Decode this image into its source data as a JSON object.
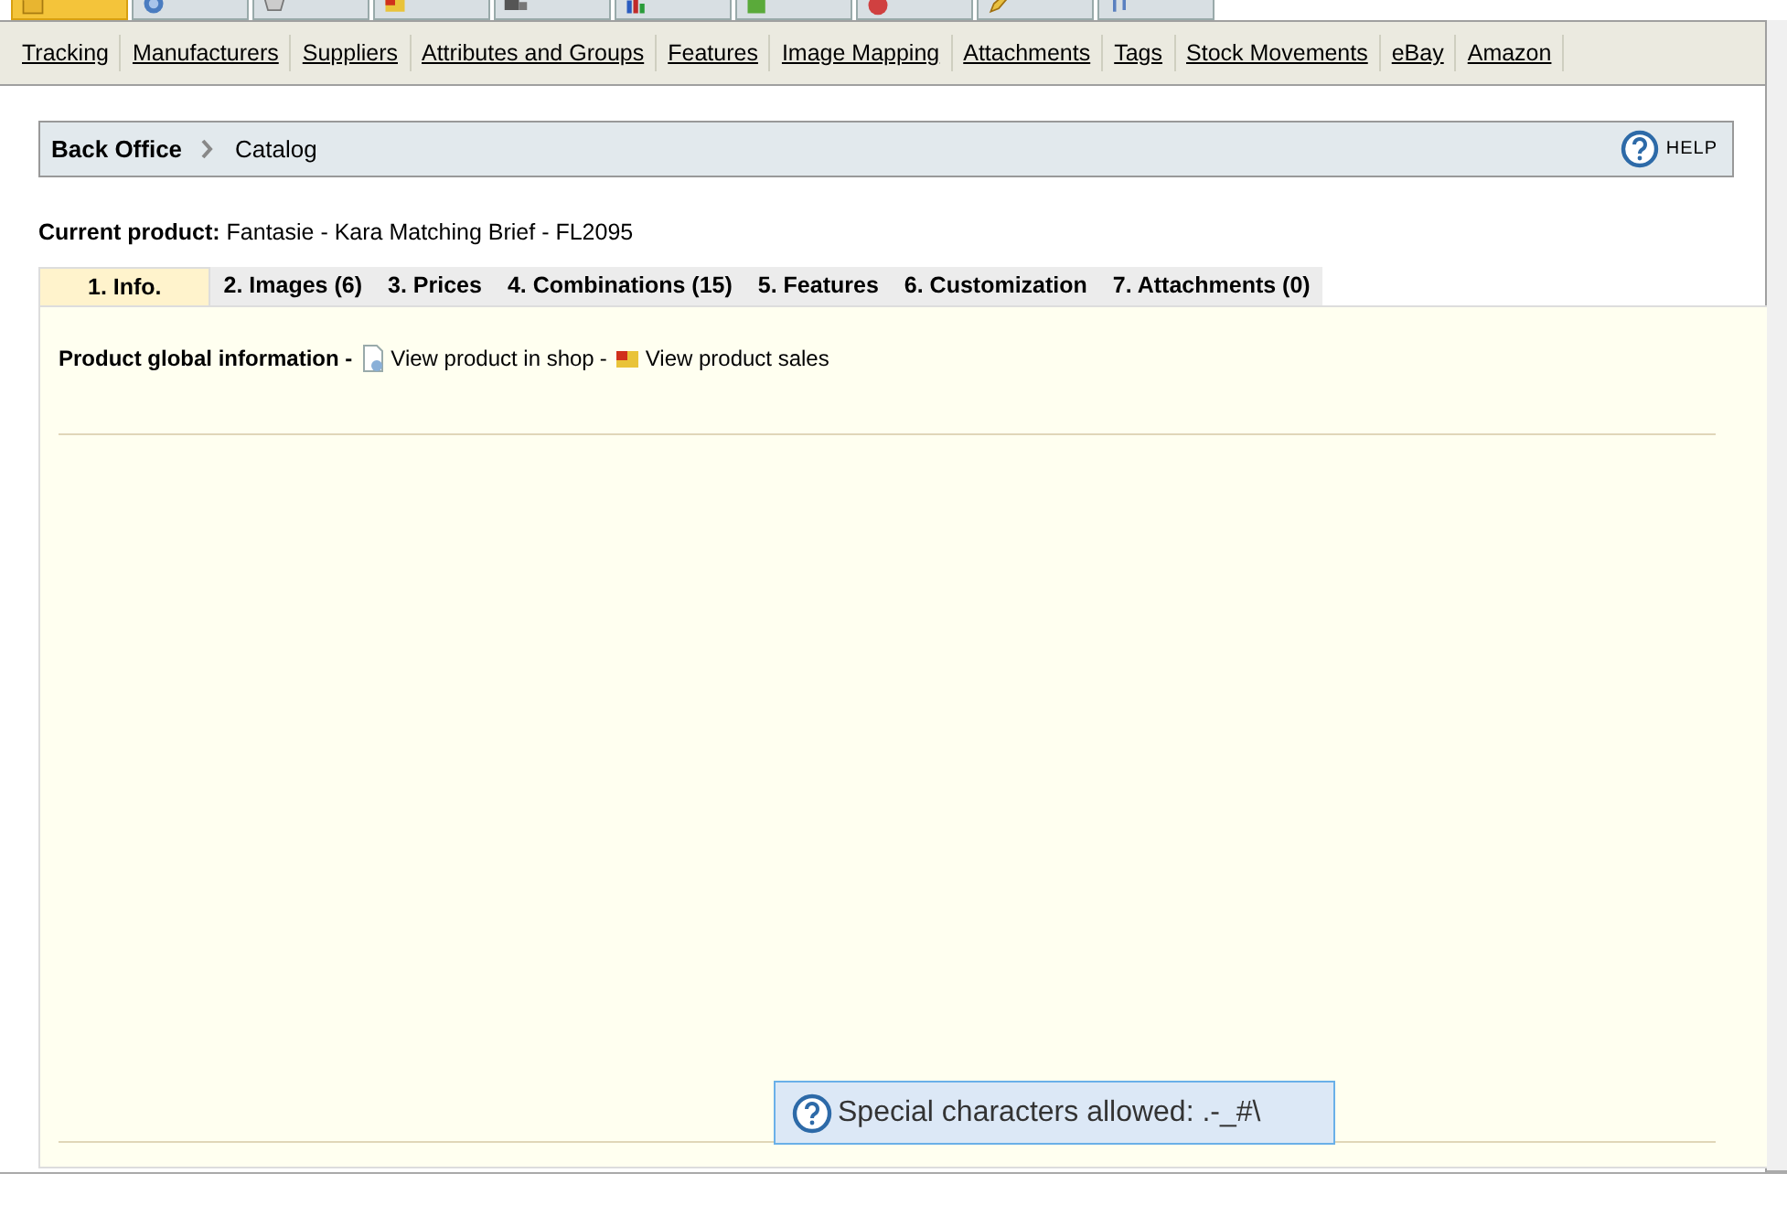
{
  "main_tabs": [
    {
      "selected": true
    },
    {
      "selected": false
    },
    {
      "selected": false
    },
    {
      "selected": false
    },
    {
      "selected": false
    },
    {
      "selected": false
    },
    {
      "selected": false
    },
    {
      "selected": false
    },
    {
      "selected": false
    },
    {
      "selected": false
    }
  ],
  "sub_nav": [
    "Tracking",
    "Manufacturers",
    "Suppliers",
    "Attributes and Groups",
    "Features",
    "Image Mapping",
    "Attachments",
    "Tags",
    "Stock Movements",
    "eBay",
    "Amazon"
  ],
  "breadcrumb": [
    "Back Office",
    "Catalog"
  ],
  "help": "HELP",
  "current_product": {
    "label": "Current product:",
    "value": "Fantasie - Kara Matching Brief - FL2095"
  },
  "product_tabs": [
    {
      "label": "1. Info.",
      "selected": true
    },
    {
      "label": "2. Images (6)",
      "selected": false
    },
    {
      "label": "3. Prices",
      "selected": false
    },
    {
      "label": "4. Combinations (15)",
      "selected": false
    },
    {
      "label": "5. Features",
      "selected": false
    },
    {
      "label": "6. Customization",
      "selected": false
    },
    {
      "label": "7. Attachments (0)",
      "selected": false
    }
  ],
  "info_line": {
    "title": "Product global information -",
    "links": [
      {
        "label": "View product in shop",
        "kind": "page"
      },
      {
        "label": "View product sales",
        "kind": "card"
      }
    ],
    "separator": "-"
  },
  "tooltip": "Special characters allowed: .-_#\\"
}
